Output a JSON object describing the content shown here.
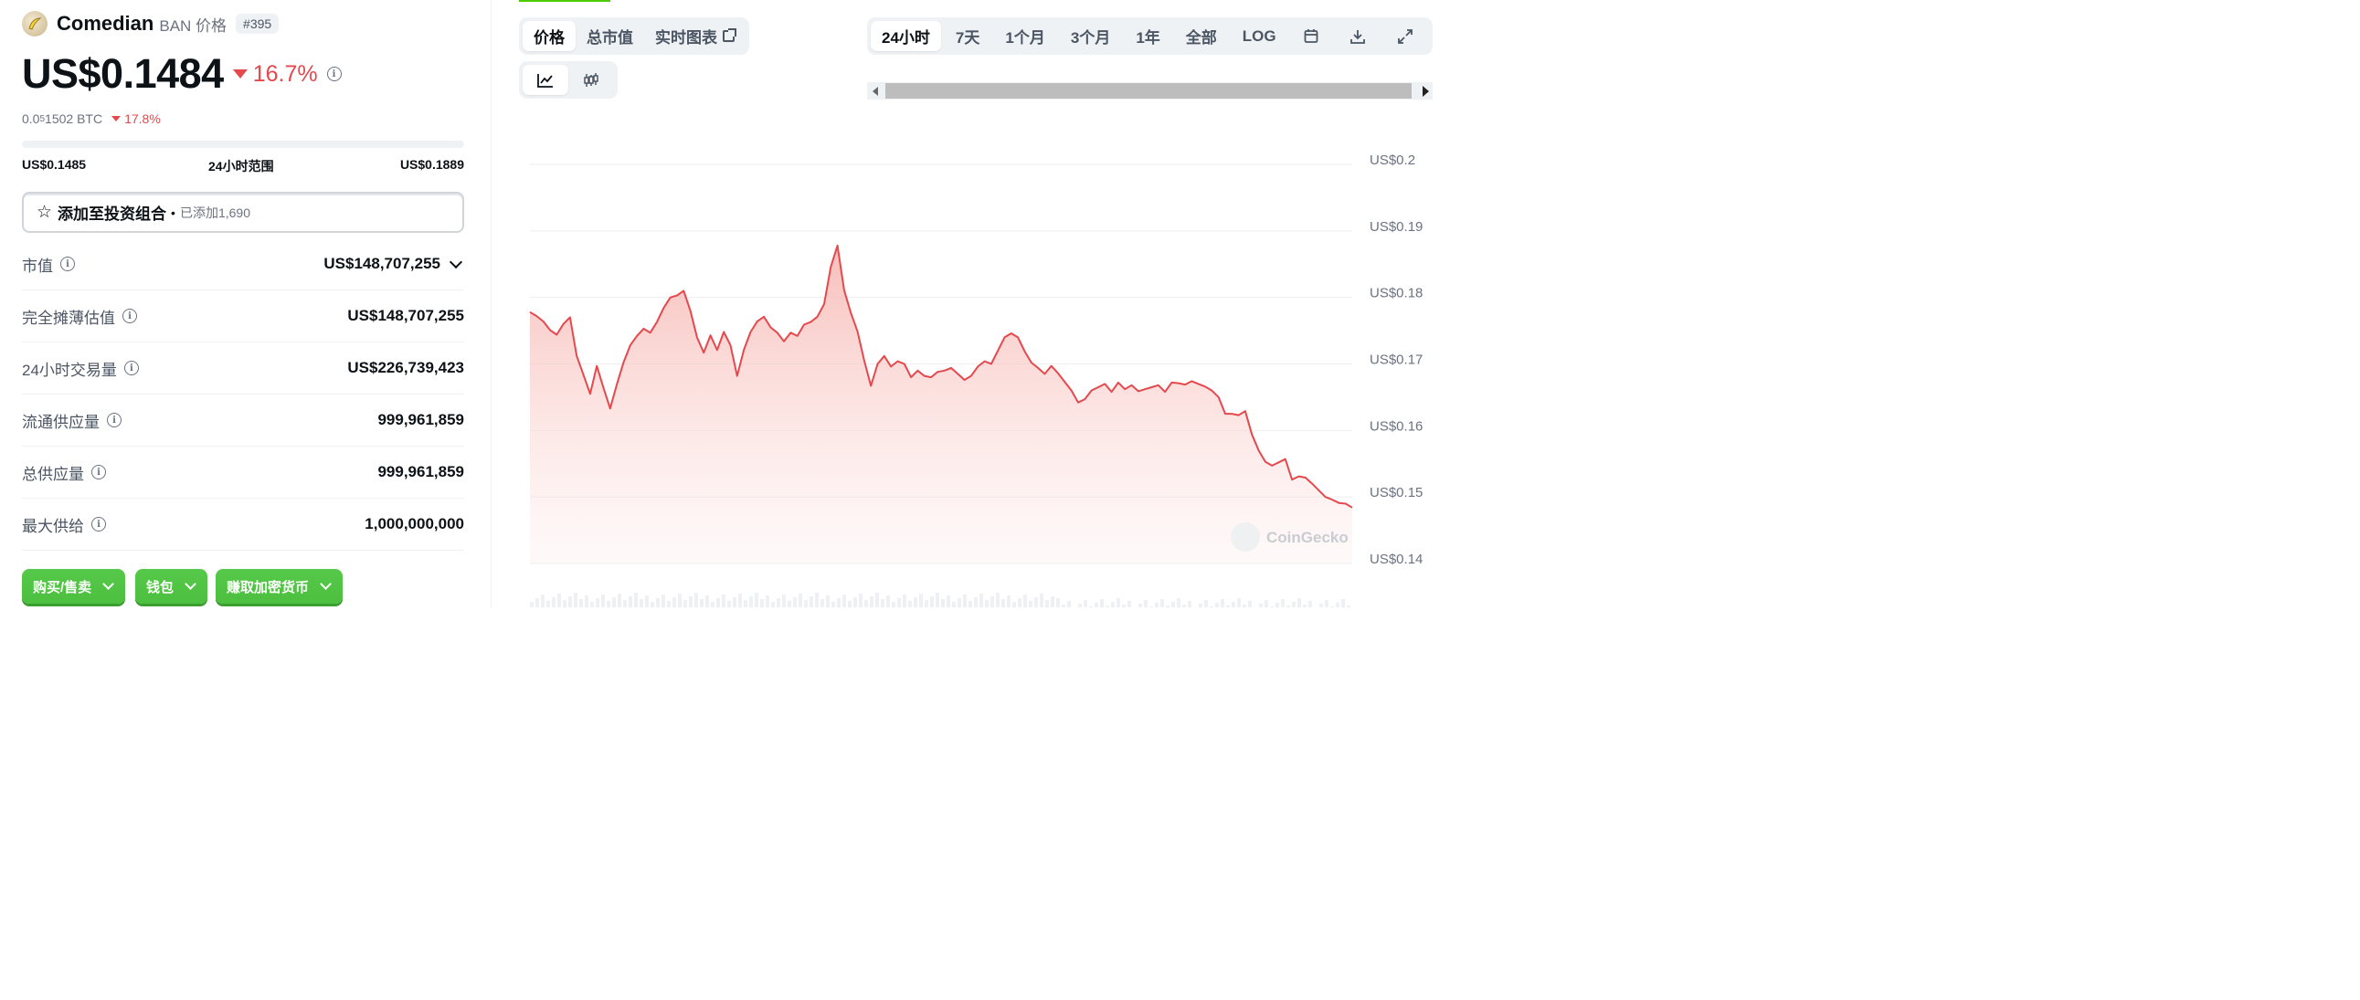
{
  "coin": {
    "name": "Comedian",
    "symbol_label": "BAN 价格",
    "rank": "#395",
    "price": "US$0.1484",
    "change_24h": "16.7%",
    "btc_prefix": "0.0",
    "btc_sub": "5",
    "btc_rest": "1502 BTC",
    "btc_change": "17.8%"
  },
  "range": {
    "low": "US$0.1485",
    "label": "24小时范围",
    "high": "US$0.1889"
  },
  "portfolio": {
    "label": "添加至投资组合",
    "added": "已添加1,690"
  },
  "stats": [
    {
      "label": "市值",
      "value": "US$148,707,255"
    },
    {
      "label": "完全摊薄估值",
      "value": "US$148,707,255"
    },
    {
      "label": "24小时交易量",
      "value": "US$226,739,423"
    },
    {
      "label": "流通供应量",
      "value": "999,961,859"
    },
    {
      "label": "总供应量",
      "value": "999,961,859"
    },
    {
      "label": "最大供给",
      "value": "1,000,000,000"
    }
  ],
  "actions": {
    "buy_sell": "购买/售卖",
    "wallet": "钱包",
    "earn": "赚取加密货币"
  },
  "chart_tabs": {
    "price": "价格",
    "market_cap": "总市值",
    "live_chart": "实时图表"
  },
  "time_tabs": {
    "d1": "24小时",
    "d7": "7天",
    "m1": "1个月",
    "m3": "3个月",
    "y1": "1年",
    "all": "全部",
    "log": "LOG"
  },
  "colors": {
    "line": "#e5484d",
    "fill": "#fbd5d3",
    "accent_green": "#4bcc00",
    "negative": "#e5484d"
  },
  "icons": {
    "line_chart": "line-chart-icon",
    "candle_chart": "candlestick-icon",
    "calendar": "calendar-icon",
    "download": "download-icon",
    "fullscreen": "fullscreen-icon"
  },
  "watermark": "CoinGecko",
  "chart_data": {
    "type": "area",
    "ylim": [
      0.14,
      0.2
    ],
    "yticks": [
      {
        "v": 0.2,
        "label": "US$0.2"
      },
      {
        "v": 0.19,
        "label": "US$0.19"
      },
      {
        "v": 0.18,
        "label": "US$0.18"
      },
      {
        "v": 0.17,
        "label": "US$0.17"
      },
      {
        "v": 0.16,
        "label": "US$0.16"
      },
      {
        "v": 0.15,
        "label": "US$0.15"
      },
      {
        "v": 0.14,
        "label": "US$0.14"
      }
    ],
    "grid": true,
    "values": [
      0.1778,
      0.1772,
      0.1764,
      0.1751,
      0.1744,
      0.176,
      0.177,
      0.1712,
      0.1684,
      0.1655,
      0.1697,
      0.1664,
      0.1633,
      0.1669,
      0.1702,
      0.1728,
      0.1742,
      0.1753,
      0.1747,
      0.1763,
      0.1784,
      0.18,
      0.1803,
      0.181,
      0.178,
      0.174,
      0.1717,
      0.1743,
      0.1721,
      0.1748,
      0.1728,
      0.1682,
      0.1721,
      0.1748,
      0.1764,
      0.1771,
      0.1755,
      0.1747,
      0.1734,
      0.1747,
      0.1742,
      0.1759,
      0.1763,
      0.1771,
      0.179,
      0.1846,
      0.1878,
      0.1811,
      0.1777,
      0.1749,
      0.1705,
      0.1667,
      0.17,
      0.1712,
      0.1696,
      0.1704,
      0.17,
      0.168,
      0.169,
      0.1682,
      0.168,
      0.1688,
      0.169,
      0.1694,
      0.1685,
      0.1676,
      0.1682,
      0.1696,
      0.1704,
      0.17,
      0.172,
      0.174,
      0.1746,
      0.174,
      0.1719,
      0.1702,
      0.1694,
      0.1685,
      0.1697,
      0.1686,
      0.1673,
      0.166,
      0.1642,
      0.1647,
      0.166,
      0.1665,
      0.167,
      0.1658,
      0.1672,
      0.1662,
      0.1668,
      0.1659,
      0.1662,
      0.1665,
      0.1668,
      0.1658,
      0.1672,
      0.1671,
      0.1669,
      0.1674,
      0.167,
      0.1666,
      0.166,
      0.165,
      0.1625,
      0.1625,
      0.1623,
      0.1629,
      0.1594,
      0.157,
      0.1553,
      0.1547,
      0.1552,
      0.1557,
      0.1526,
      0.1531,
      0.1529,
      0.152,
      0.151,
      0.15,
      0.1496,
      0.1491,
      0.149,
      0.1484
    ]
  }
}
